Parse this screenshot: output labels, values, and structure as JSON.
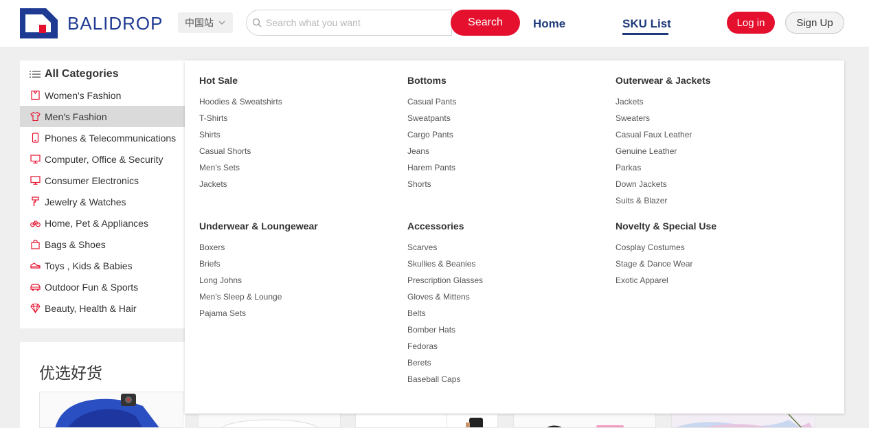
{
  "header": {
    "logo_text": "BALIDROP",
    "site_label": "中国站",
    "search_placeholder": "Search what you want",
    "search_button": "Search",
    "nav_home": "Home",
    "nav_sku": "SKU List",
    "login": "Log in",
    "signup": "Sign Up"
  },
  "colors": {
    "brand_blue": "#1f3a93",
    "accent_red": "#e4102e",
    "nav_blue": "#1f3a7a"
  },
  "sidebar": {
    "title": "All Categories",
    "items": [
      {
        "label": "Women's Fashion",
        "icon": "dress-icon"
      },
      {
        "label": "Men's Fashion",
        "icon": "shirt-icon"
      },
      {
        "label": "Phones & Telecommunications",
        "icon": "phone-icon"
      },
      {
        "label": "Computer, Office & Security",
        "icon": "monitor-icon"
      },
      {
        "label": "Consumer Electronics",
        "icon": "monitor-icon"
      },
      {
        "label": "Jewelry & Watches",
        "icon": "brush-icon"
      },
      {
        "label": "Home, Pet & Appliances",
        "icon": "bicycle-icon"
      },
      {
        "label": "Bags & Shoes",
        "icon": "bag-icon"
      },
      {
        "label": "Toys , Kids & Babies",
        "icon": "shoe-icon"
      },
      {
        "label": "Outdoor Fun & Sports",
        "icon": "car-icon"
      },
      {
        "label": "Beauty, Health & Hair",
        "icon": "diamond-icon"
      }
    ],
    "active_index": 1
  },
  "mega_menu": {
    "columns": [
      {
        "title": "Hot Sale",
        "links": [
          "Hoodies & Sweatshirts",
          "T-Shirts",
          "Shirts",
          "Casual Shorts",
          "Men's Sets",
          "Jackets"
        ]
      },
      {
        "title": "Bottoms",
        "links": [
          "Casual Pants",
          "Sweatpants",
          "Cargo Pants",
          "Jeans",
          "Harem Pants",
          "Shorts"
        ]
      },
      {
        "title": "Outerwear & Jackets",
        "links": [
          "Jackets",
          "Sweaters",
          "Casual Faux Leather",
          "Genuine Leather",
          "Parkas",
          "Down Jackets",
          "Suits & Blazer"
        ]
      },
      {
        "title": "Underwear & Loungewear",
        "links": [
          "Boxers",
          "Briefs",
          "Long Johns",
          "Men's Sleep & Lounge",
          "Pajama Sets"
        ]
      },
      {
        "title": "Accessories",
        "links": [
          "Scarves",
          "Skullies & Beanies",
          "Prescription Glasses",
          "Gloves & Mittens",
          "Belts",
          "Bomber Hats",
          "Fedoras",
          "Berets",
          "Baseball Caps"
        ]
      },
      {
        "title": "Novelty & Special Use",
        "links": [
          "Cosplay Costumes",
          "Stage & Dance Wear",
          "Exotic Apparel"
        ]
      }
    ]
  },
  "featured": {
    "title": "优选好货"
  }
}
